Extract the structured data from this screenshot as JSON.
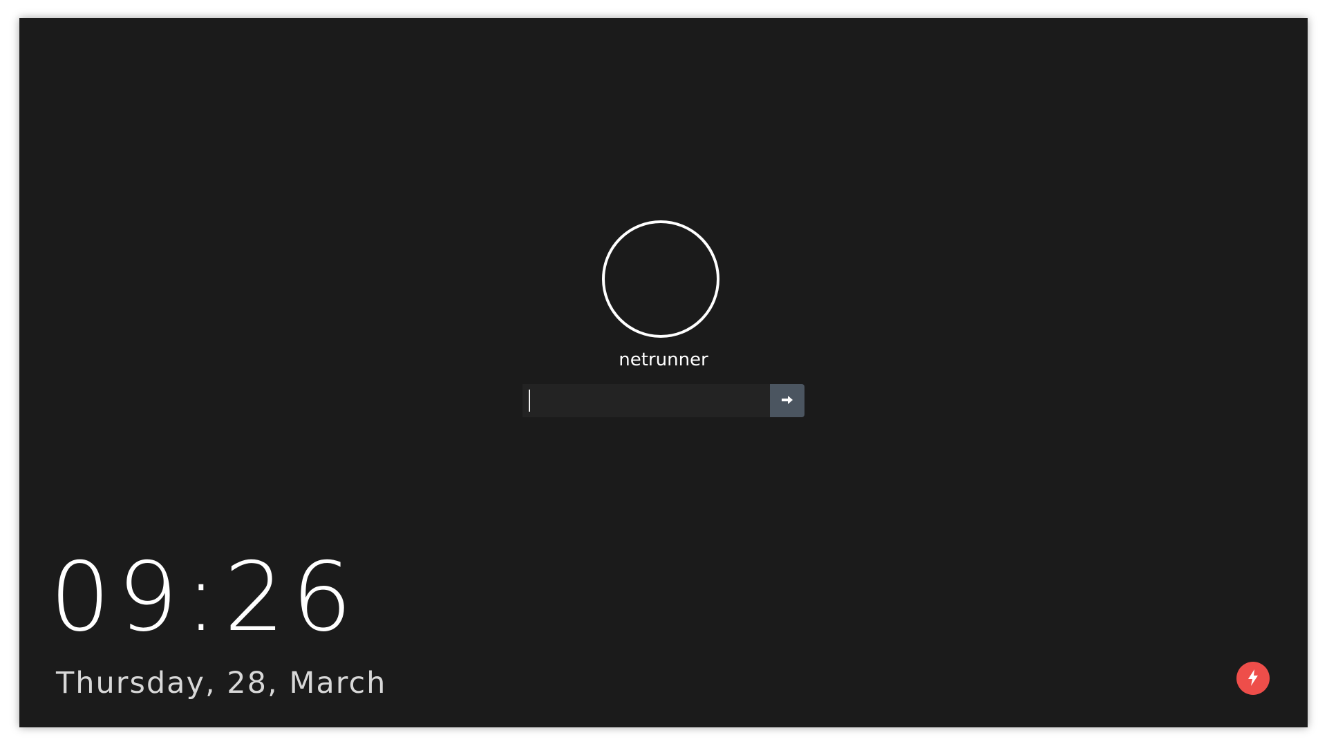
{
  "user": {
    "name": "netrunner"
  },
  "login": {
    "password_value": "",
    "placeholder": "",
    "submit_icon": "arrow-right-icon"
  },
  "clock": {
    "time": "09:26",
    "date": "Thursday, 28, March"
  },
  "power": {
    "icon": "power-bolt-icon"
  },
  "colors": {
    "background": "#1b1b1b",
    "input_background": "#232323",
    "submit_button": "#4b5560",
    "power_button": "#ee4e4a",
    "text": "#ffffff",
    "date_text": "#d8d8d8"
  }
}
